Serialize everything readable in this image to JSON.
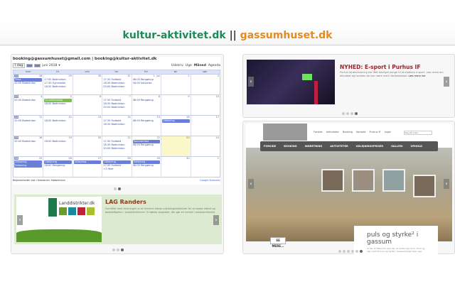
{
  "header": {
    "site1": "kultur-aktivitet.dk",
    "separator": "||",
    "site2": "gassumhuset.dk"
  },
  "calendar": {
    "title": "booking@gassumhuset@gmail.com | booking@kultur-aktivitet.dk",
    "today_btn": "I dag",
    "month": "juni 2018",
    "print": "Udskriv",
    "views": [
      "Uge",
      "Måned",
      "Agenda"
    ],
    "day_headers": [
      "man",
      "tir",
      "ons",
      "tor",
      "fre",
      "lør",
      "søn"
    ],
    "weeks": [
      {
        "num": "22",
        "days": [
          {
            "n": "28",
            "ev": [
              {
                "t": "Ferie",
                "c": "bar"
              },
              {
                "t": "20:00 Badminton"
              }
            ]
          },
          {
            "n": "29",
            "ev": [
              {
                "t": "17:00 Badminton"
              },
              {
                "t": "17:30 Gymnastik"
              },
              {
                "t": "18:30 Badminton"
              }
            ]
          },
          {
            "n": "30",
            "ev": []
          },
          {
            "n": "31",
            "ev": [
              {
                "t": "17:30 Fodbold"
              },
              {
                "t": "18:30 Badminton"
              },
              {
                "t": "20:00 Badminton"
              }
            ]
          },
          {
            "n": "1. jun",
            "ev": [
              {
                "t": "08:00 Rengøring"
              },
              {
                "t": "18:00 Indvielse"
              }
            ]
          },
          {
            "n": "2",
            "ev": []
          },
          {
            "n": "3",
            "ev": []
          }
        ]
      },
      {
        "num": "23",
        "days": [
          {
            "n": "4",
            "ev": [
              {
                "t": "20:00 Badminton"
              }
            ]
          },
          {
            "n": "5",
            "ev": [
              {
                "t": "Grundlovsdag",
                "c": "gr"
              },
              {
                "t": "18:00 Badminton"
              }
            ]
          },
          {
            "n": "6",
            "ev": []
          },
          {
            "n": "7",
            "ev": [
              {
                "t": "17:30 Fodbold"
              },
              {
                "t": "18:30 Badminton"
              },
              {
                "t": "20:00 Badminton"
              }
            ]
          },
          {
            "n": "8",
            "ev": [
              {
                "t": "08:00 Rengøring"
              }
            ]
          },
          {
            "n": "9",
            "ev": []
          },
          {
            "n": "10",
            "ev": []
          }
        ]
      },
      {
        "num": "24",
        "days": [
          {
            "n": "11",
            "ev": [
              {
                "t": "20:00 Badminton"
              }
            ]
          },
          {
            "n": "12",
            "ev": [
              {
                "t": "18:00 Badminton"
              }
            ]
          },
          {
            "n": "13",
            "ev": []
          },
          {
            "n": "14",
            "ev": [
              {
                "t": "17:30 Fodbold"
              },
              {
                "t": "18:30 Badminton"
              }
            ]
          },
          {
            "n": "15",
            "ev": [
              {
                "t": "08:00 Rengøring"
              }
            ]
          },
          {
            "n": "16",
            "ev": [
              {
                "t": "Udlejning",
                "c": "bar"
              }
            ]
          },
          {
            "n": "17",
            "ev": []
          }
        ]
      },
      {
        "num": "25",
        "days": [
          {
            "n": "18",
            "ev": [
              {
                "t": "20:00 Badminton"
              }
            ]
          },
          {
            "n": "19",
            "ev": [
              {
                "t": "18:00 Badminton"
              }
            ]
          },
          {
            "n": "20",
            "ev": []
          },
          {
            "n": "21",
            "ev": [
              {
                "t": "17:30 Fodbold"
              },
              {
                "t": "18:30 Badminton"
              },
              {
                "t": "20:00 Badminton"
              }
            ]
          },
          {
            "n": "22",
            "ev": [
              {
                "t": "Sommerfest",
                "c": "bar"
              },
              {
                "t": "08:00 Rengøring"
              }
            ]
          },
          {
            "n": "23",
            "ev": [],
            "today": true
          },
          {
            "n": "24",
            "ev": []
          }
        ]
      },
      {
        "num": "26",
        "days": [
          {
            "n": "25",
            "ev": [
              {
                "t": "Udlejning",
                "c": "bar"
              },
              {
                "t": "Udlejning",
                "c": "bar"
              }
            ]
          },
          {
            "n": "26",
            "ev": [
              {
                "t": "Udlejning",
                "c": "bar"
              },
              {
                "t": "18:00 Rengøring"
              }
            ]
          },
          {
            "n": "27",
            "ev": [
              {
                "t": "Udlejning",
                "c": "bar"
              }
            ]
          },
          {
            "n": "28",
            "ev": [
              {
                "t": "Udlejning",
                "c": "bar"
              },
              {
                "t": "17:30 Fodbold"
              },
              {
                "t": "+2 flere"
              }
            ]
          },
          {
            "n": "29",
            "ev": [
              {
                "t": "Udlejning",
                "c": "bar"
              },
              {
                "t": "08:00 Rengøring"
              }
            ]
          },
          {
            "n": "30",
            "ev": []
          },
          {
            "n": "1",
            "ev": []
          }
        ]
      }
    ],
    "tz_note": "Begivenheder vist i tidszonen: København",
    "gcal": "Google Kalender"
  },
  "lag": {
    "logo_text": "Landdistrikter.dk",
    "title": "LAG Randers",
    "text": "Formålet med foreningen er at fremme lokale udviklingsinitiativer for at skabe vækst og beskæftigelse i landdistrikterne. Vi støtter projekter, der gør en forskel i lokalsamfundet."
  },
  "news": {
    "title": "NYHED: E-sport i Purhus IF",
    "text": "Purhus Idrætsforening har fået bevilget penge til at etablere e-sport. Læs mere om tilbuddet og hvordan du kan være med i fællesskabet.",
    "more": "Læs mere her"
  },
  "site": {
    "nav": [
      "Forside",
      "Aktiviteter",
      "Booking",
      "Kontakt",
      "Purhus IF",
      "Login"
    ],
    "search": "Søg på siden",
    "menu": [
      "FORSIDE",
      "BOOKING",
      "INDRETNING",
      "AKTIVITETER",
      "UDLEJNINGSPRISER",
      "GALLERI",
      "OPHOLD"
    ],
    "headline": "puls og styrke² i gassum",
    "text": "Vi har et tilbud for alle der vil holde sig i form. Kom og vær med til puls og styrke i Gassumhuset hver uge.",
    "see_more": "SE MERE..."
  }
}
